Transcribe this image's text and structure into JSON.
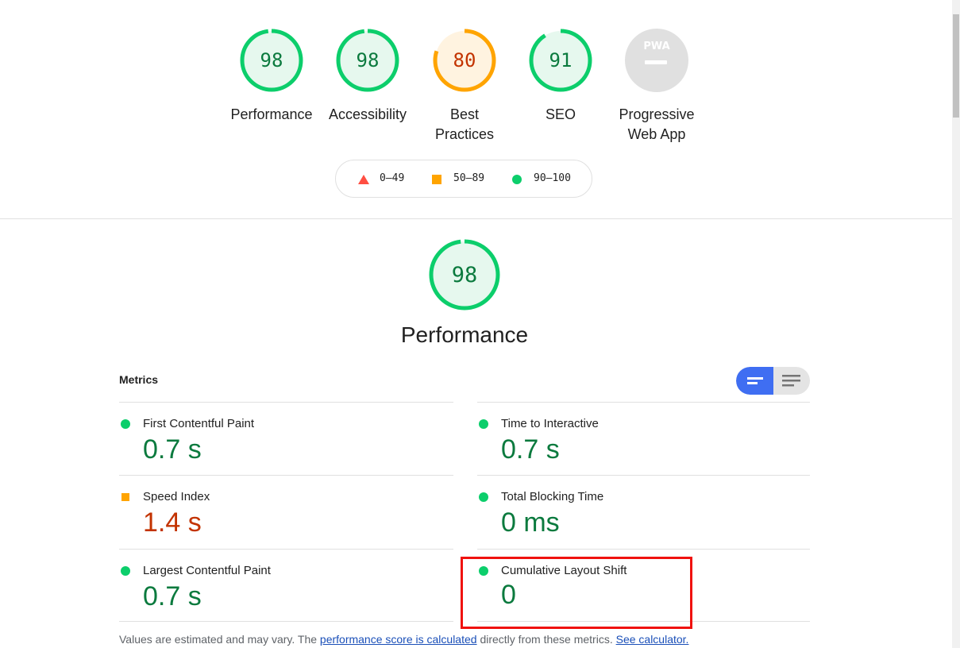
{
  "top_gauges": [
    {
      "score": "98",
      "score_fraction": 0.98,
      "label_lines": [
        "Performance"
      ],
      "rating": "pass"
    },
    {
      "score": "98",
      "score_fraction": 0.98,
      "label_lines": [
        "Accessibility"
      ],
      "rating": "pass"
    },
    {
      "score": "80",
      "score_fraction": 0.8,
      "label_lines": [
        "Best",
        "Practices"
      ],
      "rating": "average"
    },
    {
      "score": "91",
      "score_fraction": 0.91,
      "label_lines": [
        "SEO"
      ],
      "rating": "pass"
    },
    {
      "badge_text": "PWA",
      "label_lines": [
        "Progressive",
        "Web App"
      ],
      "rating": "none"
    }
  ],
  "legend": {
    "fail_range": "0–49",
    "average_range": "50–89",
    "pass_range": "90–100"
  },
  "performance": {
    "score": "98",
    "score_fraction": 0.98,
    "title": "Performance"
  },
  "metrics": {
    "heading": "Metrics",
    "items": [
      {
        "title": "First Contentful Paint",
        "value": "0.7 s",
        "rating": "pass"
      },
      {
        "title": "Time to Interactive",
        "value": "0.7 s",
        "rating": "pass"
      },
      {
        "title": "Speed Index",
        "value": "1.4 s",
        "rating": "average"
      },
      {
        "title": "Total Blocking Time",
        "value": "0 ms",
        "rating": "pass"
      },
      {
        "title": "Largest Contentful Paint",
        "value": "0.7 s",
        "rating": "pass"
      },
      {
        "title": "Cumulative Layout Shift",
        "value": "0",
        "rating": "pass",
        "highlighted": true
      }
    ]
  },
  "footer": {
    "text_before": "Values are estimated and may vary. The ",
    "link1": "performance score is calculated",
    "text_middle": " directly from these metrics. ",
    "link2": "See calculator."
  },
  "colors": {
    "pass": "#0cce6b",
    "pass_text": "#0b7a3e",
    "average": "#ffa400",
    "average_text": "#c33300",
    "fail": "#ff4e42",
    "annotation_box": "#f0120f",
    "toggle_active": "#3f6ef2"
  }
}
